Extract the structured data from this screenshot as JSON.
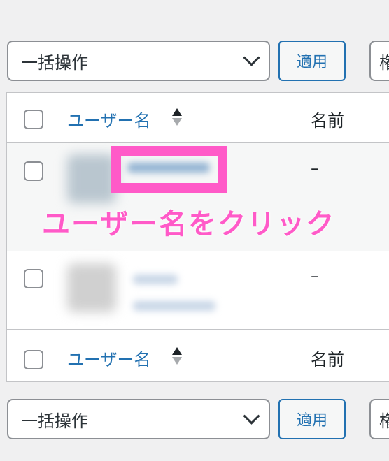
{
  "bulk_top": {
    "select_label": "一括操作",
    "apply_label": "適用",
    "next_select_label": "権"
  },
  "table": {
    "header": {
      "username_label": "ユーザー名",
      "name_label": "名前"
    },
    "rows": [
      {
        "username": "",
        "name": "–"
      },
      {
        "username": "",
        "name": "–"
      }
    ],
    "footer": {
      "username_label": "ユーザー名",
      "name_label": "名前"
    }
  },
  "annotation": {
    "text": "ユーザー名をクリック",
    "color": "#ff5ac8"
  },
  "bulk_bottom": {
    "select_label": "一括操作",
    "apply_label": "適用",
    "next_select_label": "権"
  },
  "colors": {
    "link": "#2271b1",
    "background": "#f0f0f1",
    "highlight": "#ff5ac8"
  }
}
